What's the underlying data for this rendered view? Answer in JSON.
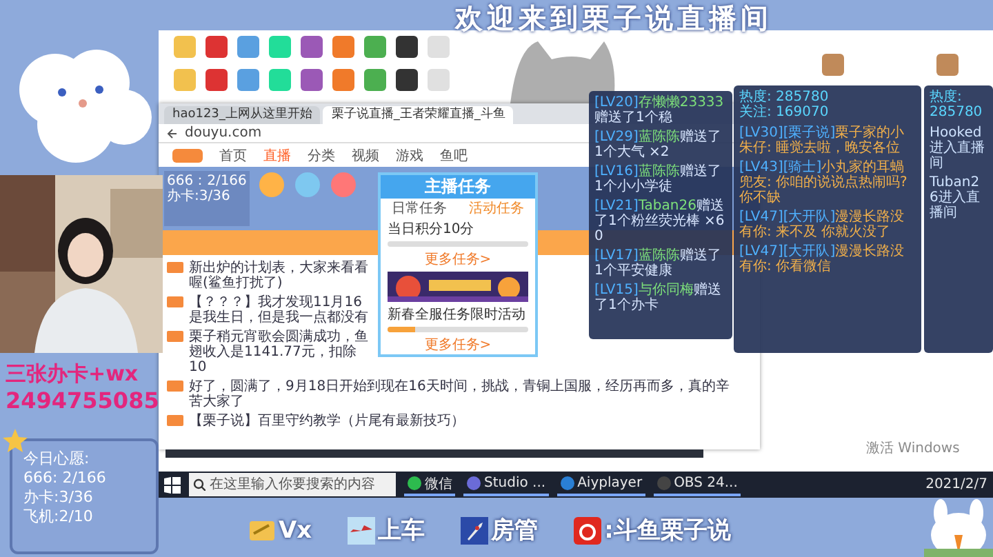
{
  "banner": {
    "title": "欢迎来到栗子说直播间"
  },
  "promo": {
    "line": "三张办卡+wx",
    "number": "2494755085"
  },
  "wishes": {
    "title": "今日心愿:",
    "items": [
      "666: 2/166",
      "办卡:3/36",
      "飞机:2/10"
    ]
  },
  "browser": {
    "tabs": [
      {
        "label": "hao123_上网从这里开始",
        "selected": false
      },
      {
        "label": "栗子说直播_王者荣耀直播_斗鱼",
        "selected": true
      }
    ],
    "address": "douyu.com",
    "nav": [
      {
        "label": "首页",
        "selected": false
      },
      {
        "label": "直播",
        "selected": true
      },
      {
        "label": "分类",
        "selected": false
      },
      {
        "label": "视频",
        "selected": false
      },
      {
        "label": "游戏",
        "selected": false
      },
      {
        "label": "鱼吧",
        "selected": false
      }
    ],
    "preview": [
      "666：2/166",
      "办卡:3/36"
    ],
    "posts": [
      "新出炉的计划表，大家来看看喔(鲨鱼打扰了)",
      "【？？？】我才发现11月16是我生日，但是我一点都没有",
      "栗子稍元宵歌会圆满成功，鱼翅收入是1141.77元，扣除10",
      "好了，圆满了，9月18日开始到现在16天时间，挑战，青铜上国服，经历再而多，真的辛苦大家了",
      "【栗子说】百里守约教学（片尾有最新技巧）"
    ]
  },
  "task_popup": {
    "title": "主播任务",
    "tabs": [
      {
        "label": "日常任务",
        "selected": false
      },
      {
        "label": "活动任务",
        "selected": true
      }
    ],
    "tasks": [
      {
        "text": "当日积分10分",
        "level": 0
      },
      {
        "text": "新春全服任务限时活动",
        "level": 0.2
      }
    ],
    "more": [
      "更多任务>",
      "更多任务>"
    ]
  },
  "gift_feed": [
    {
      "tag": "[LV20]",
      "name": "存懒懒23333",
      "action": "赠送了1个稳"
    },
    {
      "tag": "[LV29]",
      "name": "蓝陈陈",
      "action": "赠送了1个大气 ×2"
    },
    {
      "tag": "[LV16]",
      "name": "蓝陈陈",
      "action": "赠送了1个小小学徒"
    },
    {
      "tag": "[LV21]",
      "name": "Taban26",
      "action": "赠送了1个粉丝荧光棒 ×60"
    },
    {
      "tag": "[LV17]",
      "name": "蓝陈陈",
      "action": "赠送了1个平安健康"
    },
    {
      "tag": "[LV15]",
      "name": "与你同梅",
      "action": "赠送了1个办卡"
    }
  ],
  "chat": {
    "stats": [
      "热度: 285780",
      "关注: 169070"
    ],
    "messages": [
      {
        "tag": "[LV30][栗子说]",
        "name": "栗子家的小朱仔:",
        "text": "睡觉去啦，晚安各位"
      },
      {
        "tag": "[LV43][骑士]",
        "name": "小丸家的耳蝸兜友:",
        "text": "你咱的说说点热闹吗? 你不缺"
      },
      {
        "tag": "[LV47][大开队]",
        "name": "漫漫长路没有你:",
        "text": "来不及 你就火没了"
      },
      {
        "tag": "[LV47][大开队]",
        "name": "漫漫长路没有你:",
        "text": "你看微信"
      }
    ]
  },
  "entries": {
    "stats": [
      "热度: 285780"
    ],
    "items": [
      "Hooked进入直播间",
      "Tuban26进入直播间"
    ]
  },
  "activation": "激活 Windows",
  "taskbar": {
    "search_placeholder": "在这里输入你要搜索的内容",
    "apps": [
      "微信",
      "Studio ...",
      "Aiyplayer",
      "OBS 24..."
    ],
    "date": "2021/2/7"
  },
  "bottom_bar": [
    {
      "kind": "card",
      "label": "Vx"
    },
    {
      "kind": "plane",
      "label": "上车"
    },
    {
      "kind": "rocket",
      "label": "房管"
    },
    {
      "kind": "weibo",
      "label": ":斗鱼栗子说"
    }
  ]
}
